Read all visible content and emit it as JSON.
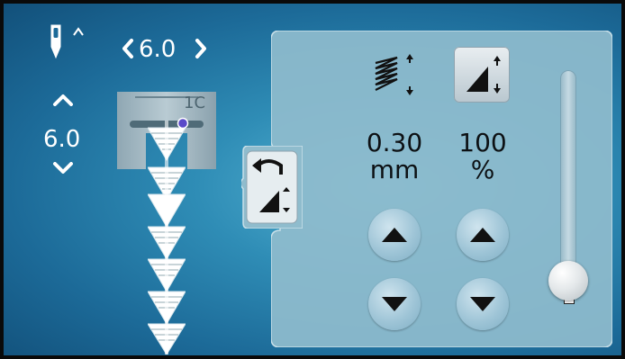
{
  "stitch_width": {
    "value": "6.0"
  },
  "needle_position": {
    "value": "6.0"
  },
  "presser_foot": {
    "label": "1C"
  },
  "stitch_density": {
    "value": "0.30",
    "unit": "mm"
  },
  "stitch_length_percent": {
    "value": "100",
    "unit": "%"
  },
  "slider": {
    "level": 0.0
  },
  "icons": {
    "needle": "needle-stop-icon",
    "density": "stitch-density-icon",
    "length": "stitch-length-icon",
    "reset": "reset-arrow-icon"
  },
  "colors": {
    "background": "#2f8db6",
    "panel": "#8fbccd",
    "dot": "#5a4ac9"
  }
}
